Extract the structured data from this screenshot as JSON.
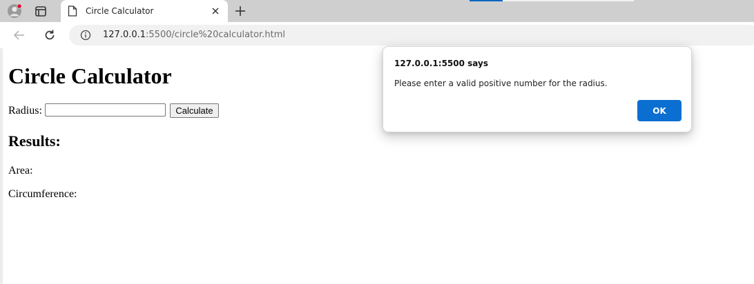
{
  "browser": {
    "tab": {
      "title": "Circle Calculator"
    },
    "address": {
      "host": "127.0.0.1",
      "rest": ":5500/circle%20calculator.html"
    }
  },
  "page": {
    "heading": "Circle Calculator",
    "radius_label": "Radius:",
    "radius_value": "",
    "calculate_label": "Calculate",
    "results_heading": "Results:",
    "area_label": "Area:",
    "circumference_label": "Circumference:"
  },
  "dialog": {
    "title": "127.0.0.1:5500 says",
    "message": "Please enter a valid positive number for the radius.",
    "ok_label": "OK"
  },
  "colors": {
    "accent": "#0b6fd1",
    "tabstrip": "#cfcfcf",
    "omnibox": "#f1f1f1"
  }
}
